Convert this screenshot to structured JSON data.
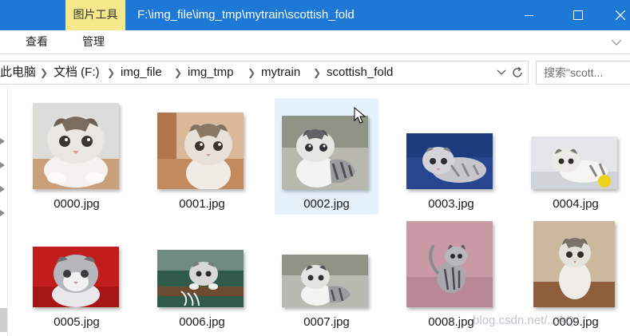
{
  "titlebar": {
    "context_tab": "图片工具",
    "path_title": "F:\\img_file\\img_tmp\\mytrain\\scottish_fold",
    "accent": "#1e79d6",
    "context_color": "#f5e98c"
  },
  "ribbon": {
    "tabs": [
      {
        "label": "查看"
      },
      {
        "label": "管理"
      }
    ]
  },
  "address": {
    "crumbs": [
      "此电脑",
      "文档 (F:)",
      "img_file",
      "img_tmp",
      "mytrain",
      "scottish_fold"
    ]
  },
  "search": {
    "placeholder": "搜索\"scott..."
  },
  "files": [
    {
      "name": "0000.jpg",
      "icon": "cat-photo"
    },
    {
      "name": "0001.jpg",
      "icon": "cat-photo"
    },
    {
      "name": "0002.jpg",
      "icon": "cat-photo",
      "selected": true
    },
    {
      "name": "0003.jpg",
      "icon": "cat-photo"
    },
    {
      "name": "0004.jpg",
      "icon": "cat-photo"
    },
    {
      "name": "0005.jpg",
      "icon": "cat-photo"
    },
    {
      "name": "0006.jpg",
      "icon": "cat-photo"
    },
    {
      "name": "0007.jpg",
      "icon": "cat-photo"
    },
    {
      "name": "0008.jpg",
      "icon": "cat-photo"
    },
    {
      "name": "0009.jpg",
      "icon": "cat-photo"
    }
  ],
  "watermark": "blog.csdn.net/...AQ",
  "selection_color": "#e5f1fb"
}
